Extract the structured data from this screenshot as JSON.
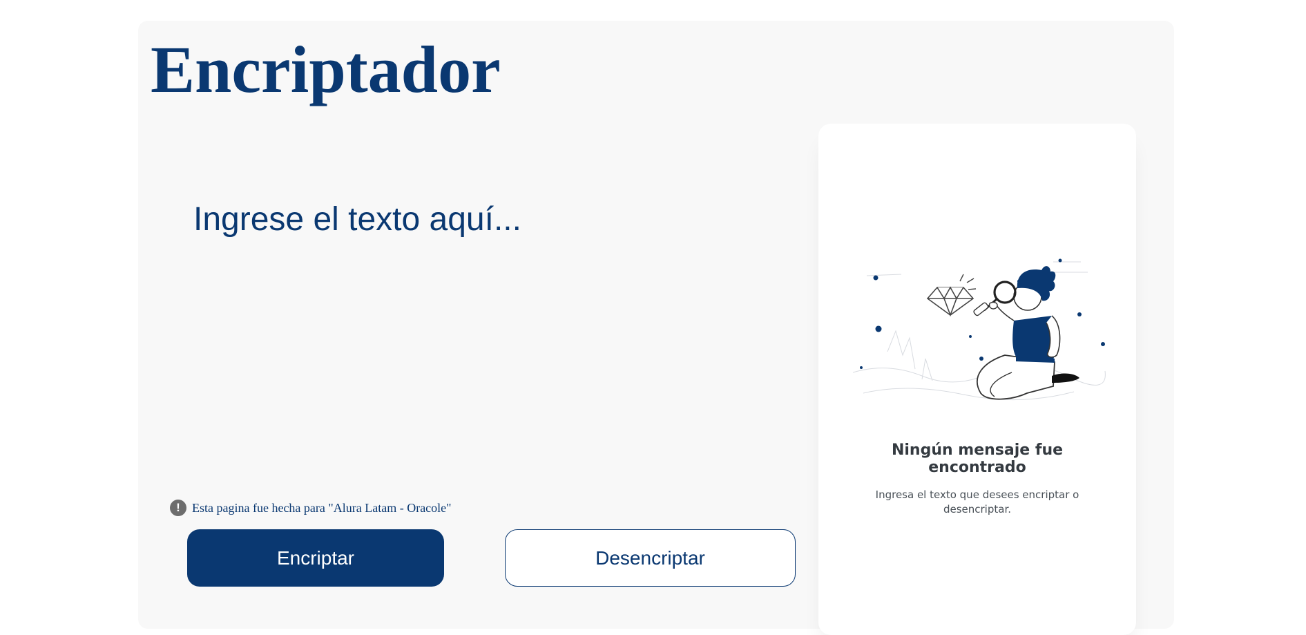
{
  "header": {
    "logo_text": "Encriptador"
  },
  "input": {
    "placeholder": "Ingrese el texto aquí...",
    "value": ""
  },
  "notice": {
    "icon": "exclamation-circle-icon",
    "text": "Esta pagina fue hecha para \"Alura Latam - Oracole\""
  },
  "buttons": {
    "encrypt_label": "Encriptar",
    "decrypt_label": "Desencriptar"
  },
  "output": {
    "illustration": "person-with-magnifying-glass-and-diamond",
    "title": "Ningún mensaje fue encontrado",
    "description": "Ingresa el texto que desees encriptar o desencriptar."
  },
  "colors": {
    "primary": "#0a3871",
    "background": "#f8f8f8",
    "card": "#ffffff",
    "muted": "#495057"
  }
}
